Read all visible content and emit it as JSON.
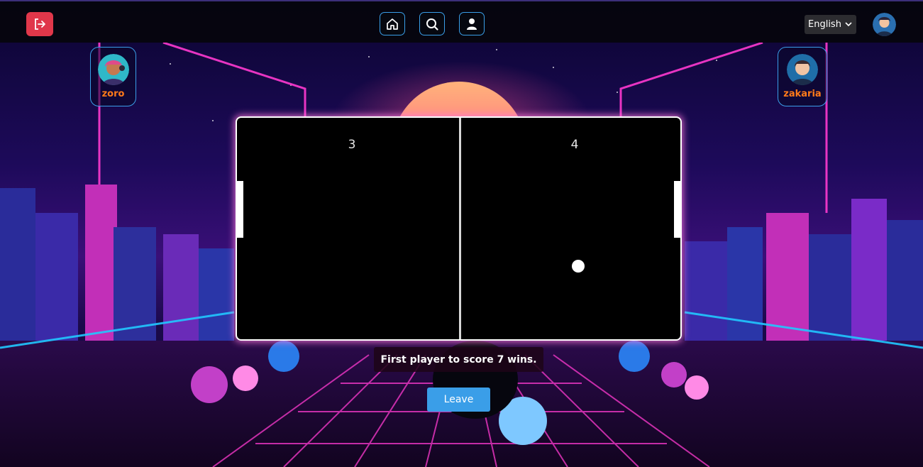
{
  "nav": {
    "logout_icon": "logout-icon",
    "home_icon": "home-icon",
    "search_icon": "search-icon",
    "profile_icon": "user-icon",
    "language": "English",
    "accent_color": "#3a9ee8",
    "logout_color": "#e0374a"
  },
  "players": {
    "left": {
      "name": "zoro"
    },
    "right": {
      "name": "zakaria"
    }
  },
  "game": {
    "score_left": "3",
    "score_right": "4",
    "rule_text": "First player to score 7 wins.",
    "leave_label": "Leave"
  },
  "colors": {
    "player_name": "#ff7a1a",
    "board_glow": "#ff78dc"
  }
}
